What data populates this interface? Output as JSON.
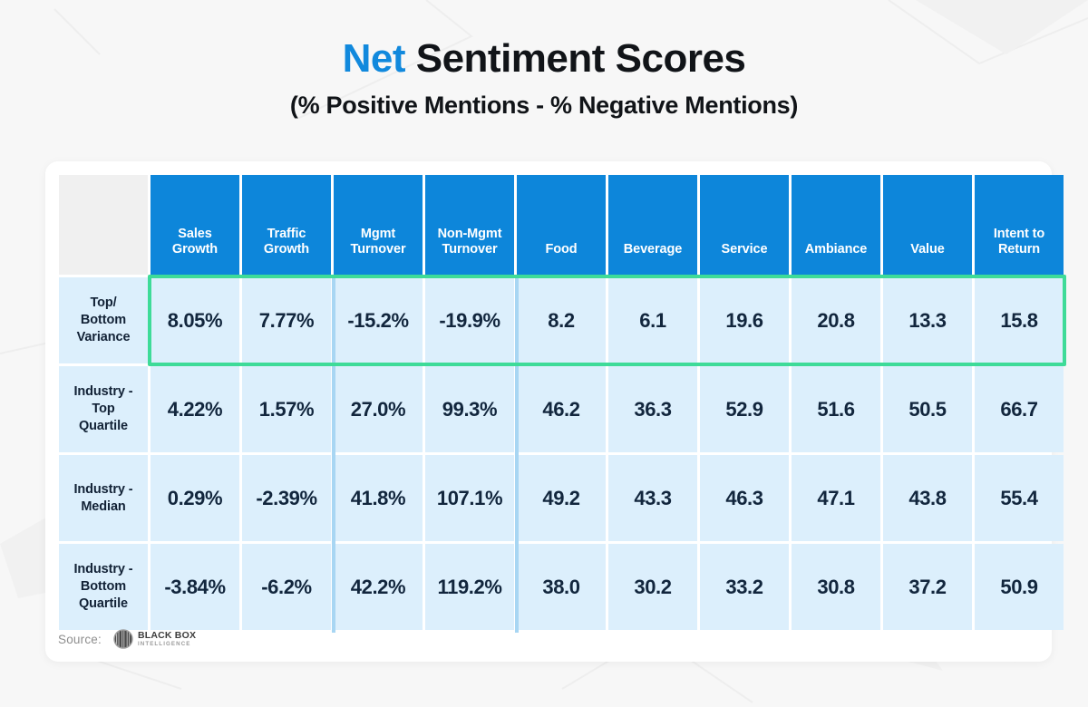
{
  "title": {
    "accent_word": "Net",
    "rest": " Sentiment Scores",
    "subtitle": "(% Positive Mentions - % Negative Mentions)",
    "accent_color": "#1189dd"
  },
  "colors": {
    "header_blue": "#0d86da",
    "cell_blue": "#dceffc",
    "highlight_green": "#3edb98",
    "divider_blue": "#a8d6f3",
    "corner_gray": "#f0f0f0",
    "text_dark": "#12263d"
  },
  "chart_data": {
    "type": "table",
    "title": "Net Sentiment Scores",
    "subtitle": "(% Positive Mentions - % Negative Mentions)",
    "corner_label": "",
    "categories": [
      "Sales Growth",
      "Traffic Growth",
      "Mgmt Turnover",
      "Non-Mgmt Turnover",
      "Food",
      "Beverage",
      "Service",
      "Ambiance",
      "Value",
      "Intent to Return"
    ],
    "row_labels": [
      "Top/ Bottom Variance",
      "Industry - Top Quartile",
      "Industry - Median",
      "Industry - Bottom Quartile"
    ],
    "rows": [
      {
        "label_lines": [
          "Top/",
          "Bottom",
          "Variance"
        ],
        "highlighted": true,
        "values": [
          "8.05%",
          "7.77%",
          "-15.2%",
          "-19.9%",
          "8.2",
          "6.1",
          "19.6",
          "20.8",
          "13.3",
          "15.8"
        ]
      },
      {
        "label_lines": [
          "Industry -",
          "Top",
          "Quartile"
        ],
        "highlighted": false,
        "values": [
          "4.22%",
          "1.57%",
          "27.0%",
          "99.3%",
          "46.2",
          "36.3",
          "52.9",
          "51.6",
          "50.5",
          "66.7"
        ]
      },
      {
        "label_lines": [
          "Industry -",
          "Median"
        ],
        "highlighted": false,
        "values": [
          "0.29%",
          "-2.39%",
          "41.8%",
          "107.1%",
          "49.2",
          "43.3",
          "46.3",
          "47.1",
          "43.8",
          "55.4"
        ]
      },
      {
        "label_lines": [
          "Industry -",
          "Bottom",
          "Quartile"
        ],
        "highlighted": false,
        "values": [
          "-3.84%",
          "-6.2%",
          "42.2%",
          "119.2%",
          "38.0",
          "30.2",
          "33.2",
          "30.8",
          "37.2",
          "50.9"
        ]
      }
    ],
    "column_headers_lines": [
      [
        "Sales",
        "Growth"
      ],
      [
        "Traffic",
        "Growth"
      ],
      [
        "Mgmt",
        "Turnover"
      ],
      [
        "Non-Mgmt",
        "Turnover"
      ],
      [
        "Food"
      ],
      [
        "Beverage"
      ],
      [
        "Service"
      ],
      [
        "Ambiance"
      ],
      [
        "Value"
      ],
      [
        "Intent to",
        "Return"
      ]
    ],
    "group_separators_after_columns": [
      2,
      4
    ],
    "grid": false,
    "legend": "none"
  },
  "footer": {
    "source_label": "Source:",
    "logo_line1": "BLACK BOX",
    "logo_line2": "INTELLIGENCE",
    "logo_icon": "blackbox-circle-mark"
  }
}
